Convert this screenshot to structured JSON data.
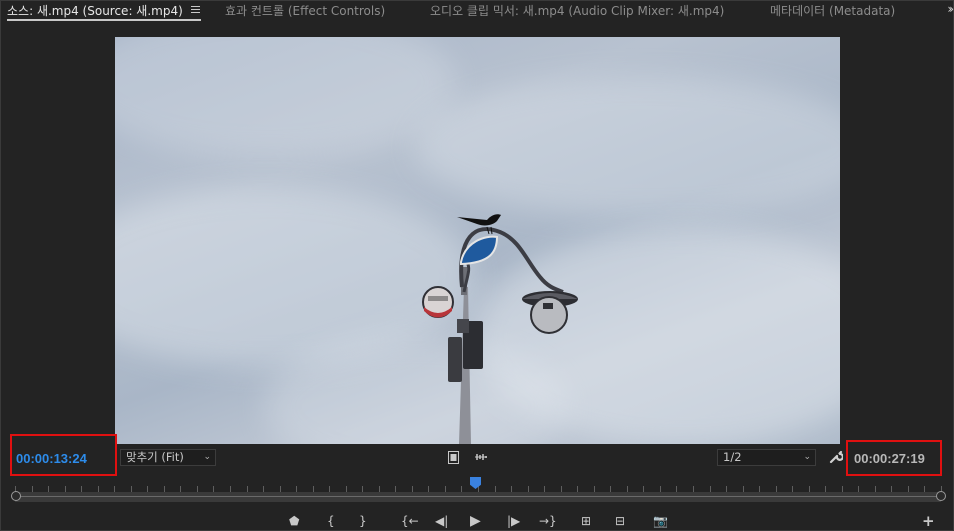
{
  "tabs": [
    {
      "label": "소스: 새.mp4 (Source: 새.mp4)",
      "active": true
    },
    {
      "label": "효과 컨트롤 (Effect Controls)",
      "active": false
    },
    {
      "label": "오디오 클립 믹서: 새.mp4 (Audio Clip Mixer: 새.mp4)",
      "active": false
    },
    {
      "label": "메타데이터 (Metadata)",
      "active": false
    }
  ],
  "monitor": {
    "current_timecode": "00:00:13:24",
    "duration_timecode": "00:00:27:19",
    "zoom_select": "맞추기 (Fit)",
    "resolution_select": "1/2",
    "playhead_position": 0.494
  },
  "colors": {
    "accent_timecode": "#2d8ceb",
    "highlight_box": "#e01010",
    "playhead": "#3a82e0"
  },
  "icons": {
    "tab_menu": "hamburger-icon",
    "overflow": "double-chevron-right-icon",
    "drag_video": "filmstrip-icon",
    "drag_audio": "audio-waveform-icon",
    "settings": "wrench-icon",
    "add_button": "plus-icon"
  },
  "transport": [
    {
      "name": "add-marker-button",
      "glyph": "⬟"
    },
    {
      "name": "mark-in-button",
      "glyph": "{"
    },
    {
      "name": "mark-out-button",
      "glyph": "}"
    },
    {
      "name": "go-to-in-button",
      "glyph": "{←"
    },
    {
      "name": "step-back-button",
      "glyph": "◀|"
    },
    {
      "name": "play-button",
      "glyph": "▶"
    },
    {
      "name": "step-forward-button",
      "glyph": "|▶"
    },
    {
      "name": "go-to-out-button",
      "glyph": "→}"
    },
    {
      "name": "insert-button",
      "glyph": "⊞"
    },
    {
      "name": "overwrite-button",
      "glyph": "⊟"
    },
    {
      "name": "export-frame-button",
      "glyph": "📷"
    }
  ]
}
